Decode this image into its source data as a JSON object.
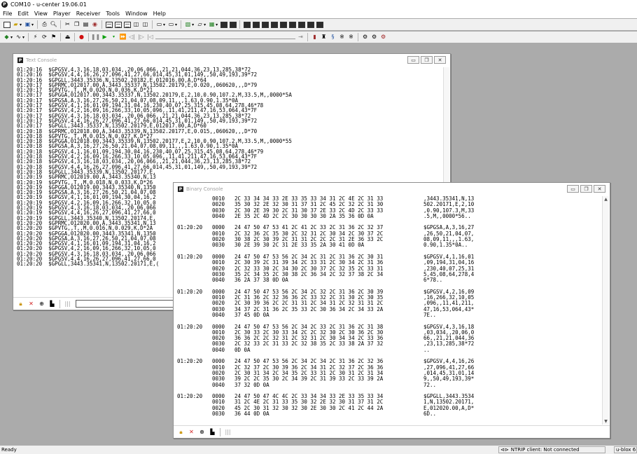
{
  "app": {
    "title": "COM10 - u-center 19.06.01"
  },
  "menu": [
    "File",
    "Edit",
    "View",
    "Player",
    "Receiver",
    "Tools",
    "Window",
    "Help"
  ],
  "text_console": {
    "title": "Text Console",
    "lines": [
      "01:20:16  $GPGSV,4,3,16,18,03,034,,20,06,066,,21,21,044,36,23,13,285,38*72",
      "01:20:16  $GPGSV,4,4,16,26,27,096,41,27,66,014,45,31,01,149,,50,49,193,39*72",
      "01:20:16  $GPGLL,3443.35336,N,13502.20182,E,012016.00,A,D*64",
      "01:20:17  $GPRMC,012017.00,A,3443.35337,N,13502.20179,E,0.020,,060620,,,D*79",
      "01:20:17  $GPVTG,,T,,M,0.020,N,0.036,K,D*21",
      "01:20:17  $GPGGA,012017.00,3443.35337,N,13502.20179,E,2,10,0.90,107.2,M,33.5,M,,0000*5A",
      "01:20:17  $GPGSA,A,3,16,27,26,50,21,04,07,08,09,11,,,1.63,0.90,1.35*0A",
      "01:20:17  $GPGSV,4,1,16,01,09,194,31,04,16,230,40,07,25,315,45,08,64,278,46*78",
      "01:20:17  $GPGSV,4,2,16,09,16,266,33,10,05,096,,11,41,211,47,16,53,064,43*7F",
      "01:20:17  $GPGSV,4,3,16,18,03,034,,20,06,066,,21,21,044,36,23,13,285,38*72",
      "01:20:17  $GPGSV,4,4,16,26,27,096,41,27,66,014,45,31,01,149,,50,49,193,39*72",
      "01:20:17  $GPGLL,3443.35337,N,13502.20179,E,012017.00,A,D*60",
      "01:20:18  $GPRMC,012018.00,A,3443.35339,N,13502.20177,E,0.015,,060620,,,D*70",
      "01:20:18  $GPVTG,,T,,M,0.015,N,0.027,K,D*27",
      "01:20:18  $GPGGA,012018.00,3443.35339,N,13502.20177,E,2,10,0.90,107.2,M,33.5,M,,0000*55",
      "01:20:18  $GPGSA,A,3,16,27,26,50,21,04,07,08,09,11,,,1.63,0.90,1.35*0A",
      "01:20:18  $GPGSV,4,1,16,01,09,194,30,04,16,230,40,07,25,315,45,08,64,278,46*79",
      "01:20:18  $GPGSV,4,2,16,09,16,266,33,10,05,096,,11,41,211,47,16,53,064,43*7F",
      "01:20:18  $GPGSV,4,3,16,18,03,034,,20,06,066,,21,21,044,36,23,13,285,38*72",
      "01:20:18  $GPGSV,4,4,16,26,27,096,41,27,66,014,45,31,01,149,,50,49,193,39*72",
      "01:20:18  $GPGLL,3443.35339,N,13502.20177,E,",
      "01:20:19  $GPRMC,012019.00,A,3443.35340,N,13",
      "01:20:19  $GPVTG,,T,,M,0.018,N,0.033,K,D*26",
      "01:20:19  $GPGGA,012019.00,3443.35340,N,1350",
      "01:20:19  $GPGSA,A,3,16,27,26,50,21,04,07,08",
      "01:20:19  $GPGSV,4,1,16,01,09,194,30,04,16,2",
      "01:20:19  $GPGSV,4,2,16,09,16,266,32,10,05,0",
      "01:20:19  $GPGSV,4,3,16,18,03,034,,20,06,066",
      "01:20:19  $GPGSV,4,4,16,26,27,096,41,27,66,0",
      "01:20:19  $GPGLL,3443.35340,N,13502.20174,E,",
      "01:20:20  $GPRMC,012020.00,A,3443.35341,N,13",
      "01:20:20  $GPVTG,,T,,M,0.016,N,0.029,K,D*2A",
      "01:20:20  $GPGGA,012020.00,3443.35341,N,1350",
      "01:20:20  $GPGSA,A,3,16,27,26,50,21,04,07,08",
      "01:20:20  $GPGSV,4,1,16,01,09,194,31,04,16,2",
      "01:20:20  $GPGSV,4,2,16,09,16,266,32,10,05,0",
      "01:20:20  $GPGSV,4,3,16,18,03,034,,20,06,066",
      "01:20:20  $GPGSV,4,4,16,26,27,096,41,27,66,0",
      "01:20:20  $GPGLL,3443.35341,N,13502.20171,E,("
    ]
  },
  "binary_console": {
    "title": "Binary Console",
    "blocks": [
      {
        "time": "",
        "rows": [
          {
            "off": "0010",
            "hex": "2C 33 34 34 33 2E 33 35 33 34 31 2C 4E 2C 31 33",
            "asc": ",3443.35341,N,13"
          },
          {
            "off": "0020",
            "hex": "35 30 32 2E 32 30 31 37 31 2C 45 2C 32 2C 31 30",
            "asc": "502.20171,E,2,10"
          },
          {
            "off": "0030",
            "hex": "2C 30 2E 39 30 2C 31 30 37 2E 33 2C 4D 2C 33 33",
            "asc": ",0.90,107.3,M,33"
          },
          {
            "off": "0040",
            "hex": "2E 35 2C 4D 2C 2C 30 30 30 30 2A 35 36 0D 0A",
            "asc": ".5,M,,0000*56.."
          }
        ]
      },
      {
        "time": "01:20:20",
        "rows": [
          {
            "off": "0000",
            "hex": "24 47 50 47 53 41 2C 41 2C 33 2C 31 36 2C 32 37",
            "asc": "$GPGSA,A,3,16,27"
          },
          {
            "off": "0010",
            "hex": "2C 32 36 2C 35 30 2C 32 31 2C 30 34 2C 30 37 2C",
            "asc": ",26,50,21,04,07,"
          },
          {
            "off": "0020",
            "hex": "30 38 2C 30 39 2C 31 31 2C 2C 2C 31 2E 36 33 2C",
            "asc": "08,09,11,,,1.63,"
          },
          {
            "off": "0030",
            "hex": "30 2E 39 30 2C 31 2E 33 35 2A 30 41 0D 0A",
            "asc": "0.90,1.35*0A.."
          }
        ]
      },
      {
        "time": "01:20:20",
        "rows": [
          {
            "off": "0000",
            "hex": "24 47 50 47 53 56 2C 34 2C 31 2C 31 36 2C 30 31",
            "asc": "$GPGSV,4,1,16,01"
          },
          {
            "off": "0010",
            "hex": "2C 30 39 2C 31 39 34 2C 33 31 2C 30 34 2C 31 36",
            "asc": ",09,194,31,04,16"
          },
          {
            "off": "0020",
            "hex": "2C 32 33 30 2C 34 30 2C 30 37 2C 32 35 2C 33 31",
            "asc": ",230,40,07,25,31"
          },
          {
            "off": "0030",
            "hex": "35 2C 34 35 2C 30 38 2C 36 34 2C 32 37 38 2C 34",
            "asc": "5,45,08,64,278,4"
          },
          {
            "off": "0040",
            "hex": "36 2A 37 38 0D 0A",
            "asc": "6*78.."
          }
        ]
      },
      {
        "time": "01:20:20",
        "rows": [
          {
            "off": "0000",
            "hex": "24 47 50 47 53 56 2C 34 2C 32 2C 31 36 2C 30 39",
            "asc": "$GPGSV,4,2,16,09"
          },
          {
            "off": "0010",
            "hex": "2C 31 36 2C 32 36 36 2C 33 32 2C 31 30 2C 30 35",
            "asc": ",16,266,32,10,05"
          },
          {
            "off": "0020",
            "hex": "2C 30 39 36 2C 2C 31 31 2C 34 31 2C 32 31 31 2C",
            "asc": ",096,,11,41,211,"
          },
          {
            "off": "0030",
            "hex": "34 37 2C 31 36 2C 35 33 2C 30 36 34 2C 34 33 2A",
            "asc": "47,16,53,064,43*"
          },
          {
            "off": "0040",
            "hex": "37 45 0D 0A",
            "asc": "7E.."
          }
        ]
      },
      {
        "time": "01:20:20",
        "rows": [
          {
            "off": "0000",
            "hex": "24 47 50 47 53 56 2C 34 2C 33 2C 31 36 2C 31 38",
            "asc": "$GPGSV,4,3,16,18"
          },
          {
            "off": "0010",
            "hex": "2C 30 33 2C 30 33 34 2C 2C 32 30 2C 30 36 2C 30",
            "asc": ",03,034,,20,06,0"
          },
          {
            "off": "0020",
            "hex": "36 36 2C 2C 32 31 2C 32 31 2C 30 34 34 2C 33 36",
            "asc": "66,,21,21,044,36"
          },
          {
            "off": "0030",
            "hex": "2C 32 33 2C 31 33 2C 32 38 35 2C 33 38 2A 37 32",
            "asc": ",23,13,285,38*72"
          },
          {
            "off": "0040",
            "hex": "0D 0A",
            "asc": ".."
          }
        ]
      },
      {
        "time": "01:20:20",
        "rows": [
          {
            "off": "0000",
            "hex": "24 47 50 47 53 56 2C 34 2C 34 2C 31 36 2C 32 36",
            "asc": "$GPGSV,4,4,16,26"
          },
          {
            "off": "0010",
            "hex": "2C 32 37 2C 30 39 36 2C 34 31 2C 32 37 2C 36 36",
            "asc": ",27,096,41,27,66"
          },
          {
            "off": "0020",
            "hex": "2C 30 31 34 2C 34 35 2C 33 31 2C 30 31 2C 31 34",
            "asc": ",014,45,31,01,14"
          },
          {
            "off": "0030",
            "hex": "39 2C 2C 35 30 2C 34 39 2C 31 39 33 2C 33 39 2A",
            "asc": "9,,50,49,193,39*"
          },
          {
            "off": "0040",
            "hex": "37 32 0D 0A",
            "asc": "72.."
          }
        ]
      },
      {
        "time": "01:20:20",
        "rows": [
          {
            "off": "0000",
            "hex": "24 47 50 47 4C 4C 2C 33 34 34 33 2E 33 35 33 34",
            "asc": "$GPGLL,3443.3534"
          },
          {
            "off": "0010",
            "hex": "31 2C 4E 2C 31 33 35 30 32 2E 32 30 31 37 31 2C",
            "asc": "1,N,13502.20171,"
          },
          {
            "off": "0020",
            "hex": "45 2C 30 31 32 30 32 30 2E 30 30 2C 41 2C 44 2A",
            "asc": "E,012020.00,A,D*"
          },
          {
            "off": "0030",
            "hex": "36 44 0D 0A",
            "asc": "6D.."
          }
        ]
      }
    ]
  },
  "statusbar": {
    "ready": "Ready",
    "ntrip": "NTRIP client: Not connected",
    "receiver": "u-blox 6"
  },
  "icons": [
    "new-file-icon",
    "open-icon",
    "save-icon",
    "print-icon",
    "cut-icon",
    "copy-icon",
    "paste-icon",
    "record-icon",
    "play-icon",
    "pause-icon",
    "lock-icon",
    "close-icon",
    "zoom-icon"
  ]
}
